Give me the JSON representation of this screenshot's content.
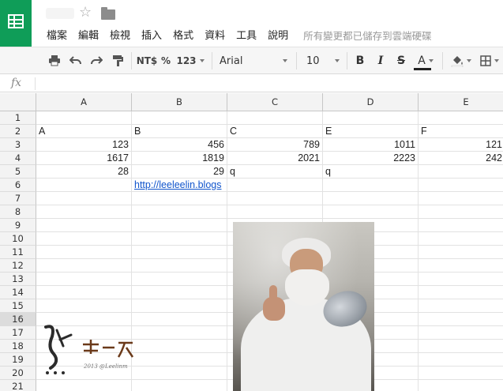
{
  "header": {
    "menu": [
      "檔案",
      "編輯",
      "檢視",
      "插入",
      "格式",
      "資料",
      "工具",
      "說明"
    ],
    "save_status": "所有變更都已儲存到雲端硬碟"
  },
  "toolbar": {
    "currency": "NT$",
    "percent": "%",
    "number_format": "123",
    "font": "Arial",
    "font_size": "10",
    "bold": "B",
    "italic": "I",
    "strikethrough": "S",
    "text_color": "A",
    "text_color_value": "#222222"
  },
  "formula_bar": {
    "fx": "fx",
    "value": ""
  },
  "columns": [
    "A",
    "B",
    "C",
    "D",
    "E"
  ],
  "rows": [
    "1",
    "2",
    "3",
    "4",
    "5",
    "6",
    "7",
    "8",
    "9",
    "10",
    "11",
    "12",
    "13",
    "14",
    "15",
    "16",
    "17",
    "18",
    "19",
    "20",
    "21"
  ],
  "active_row": "16",
  "cells": {
    "r2": [
      "A",
      "B",
      "C",
      "E",
      "F"
    ],
    "r3": [
      "123",
      "456",
      "789",
      "1011",
      "121"
    ],
    "r4": [
      "1617",
      "1819",
      "2021",
      "2223",
      "242"
    ],
    "r5": [
      "28",
      "29",
      "q",
      "q",
      ""
    ],
    "r6b": "http://leeleelin.blogs"
  },
  "watermark": {
    "text": "梅問題・教學網",
    "sub": "2013 @Leelinm"
  },
  "colors": {
    "brand_green": "#0f9d58",
    "link": "#1155cc",
    "header_bg": "#f3f3f3"
  }
}
